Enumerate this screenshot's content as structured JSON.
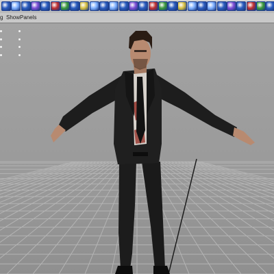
{
  "menubar": {
    "items": [
      {
        "label": "g"
      },
      {
        "label": "Show"
      },
      {
        "label": "Panels"
      }
    ]
  },
  "shelf": {
    "icons": [
      "sphere-icon",
      "cube-icon",
      "cylinder-icon",
      "cone-icon",
      "plane-icon",
      "torus-icon",
      "nurbs-circle-icon",
      "render-icon",
      "ipr-icon",
      "material-icon",
      "light-icon",
      "camera-icon",
      "curve-icon",
      "surface-icon",
      "loft-icon",
      "extrude-icon",
      "revolve-icon",
      "bevel-icon",
      "deform-icon",
      "lattice-icon",
      "cluster-icon",
      "joint-icon",
      "ik-handle-icon",
      "skin-icon",
      "paint-weights-icon",
      "blend-shape-icon",
      "wire-icon",
      "sculpt-icon"
    ],
    "colors": {
      "primary": "#2c5dbf",
      "highlight": "#7fb0ff",
      "accent_red": "#c03030",
      "accent_green": "#3b9a3b",
      "accent_yellow": "#d8c040",
      "accent_purple": "#7d4fd6"
    }
  },
  "viewport": {
    "background": "#9a9a9a",
    "grid_color": "#b4b4b4",
    "grid_axis_color": "#1c1c1c"
  },
  "character": {
    "suit_color": "#1c1c1c",
    "shirt_color": "#d7d2cc",
    "skin_color": "#b88a70",
    "hair_color": "#2a1c14",
    "tie_color": "#121212",
    "stain_color": "#8c1c14"
  }
}
